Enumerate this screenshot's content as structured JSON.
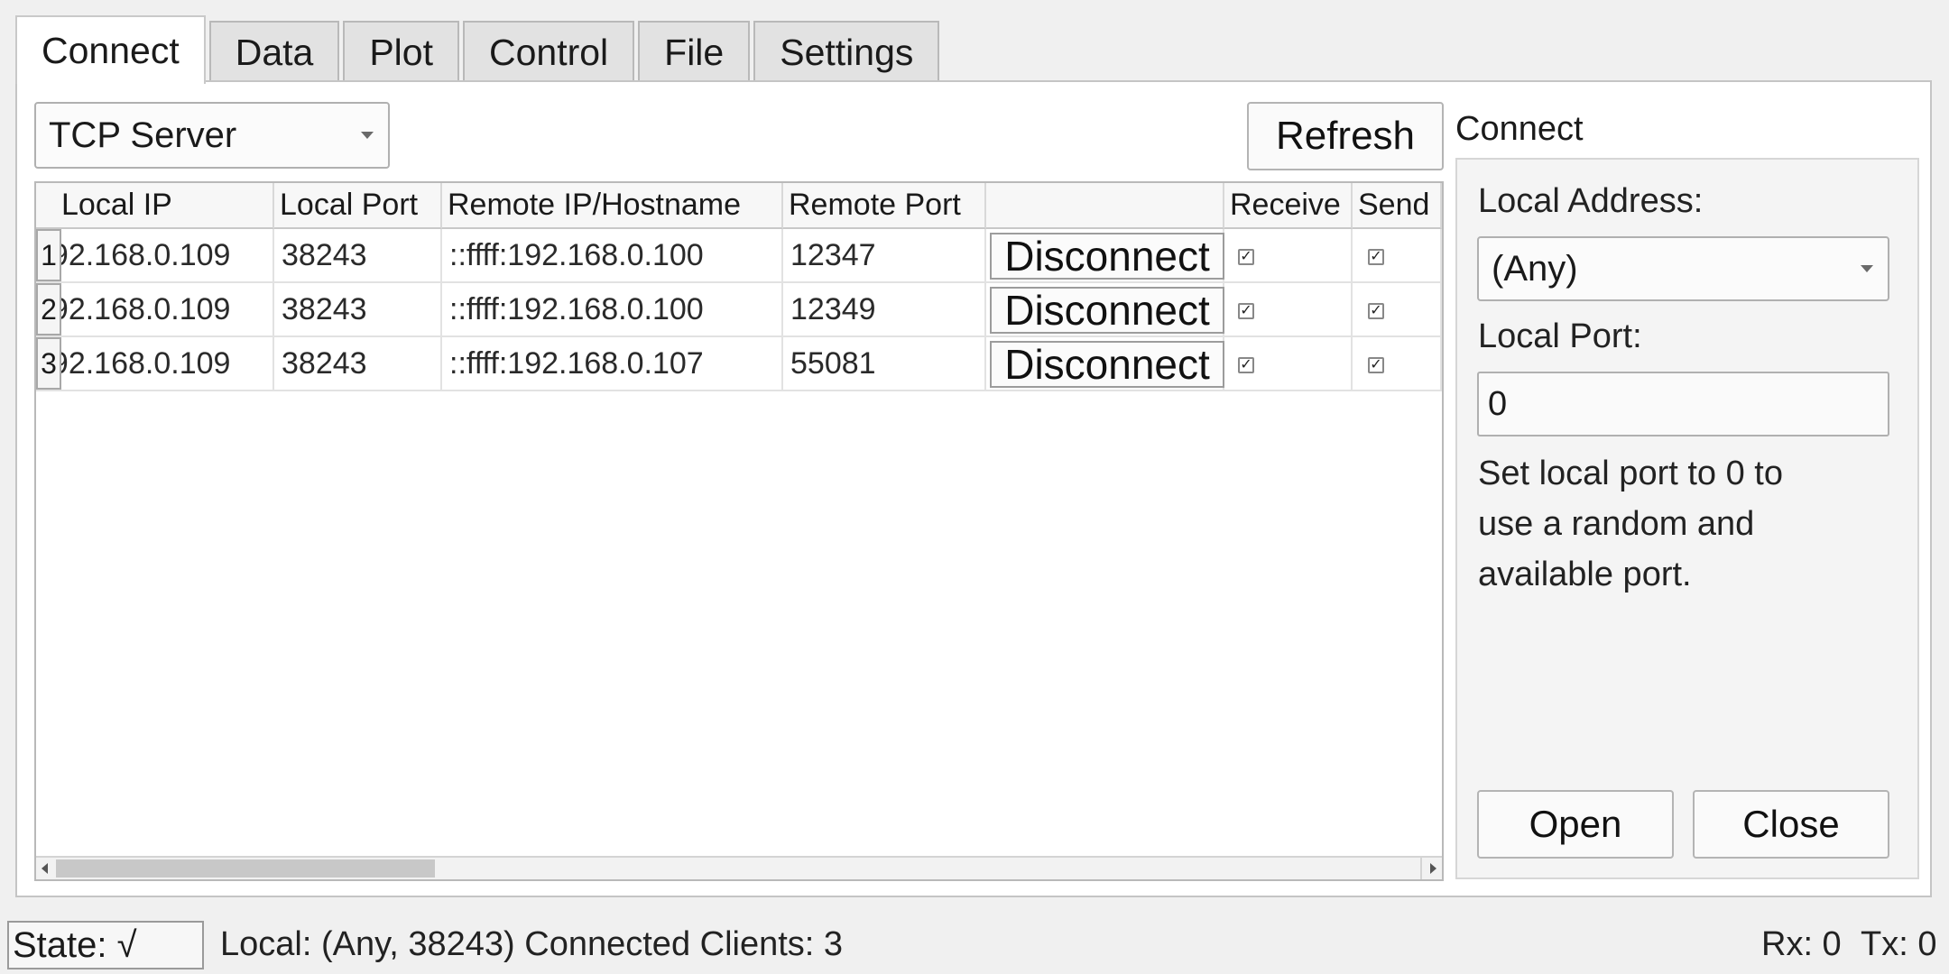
{
  "tabs": [
    "Connect",
    "Data",
    "Plot",
    "Control",
    "File",
    "Settings"
  ],
  "mode_select": "TCP Server",
  "refresh_label": "Refresh",
  "table": {
    "headers": [
      "Local IP",
      "Local Port",
      "Remote IP/Hostname",
      "Remote Port",
      "",
      "Receive",
      "Send"
    ],
    "rows": [
      {
        "num": "1",
        "local_ip": "192.168.0.109",
        "local_port": "38243",
        "remote_ip": "::ffff:192.168.0.100",
        "remote_port": "12347",
        "action": "Disconnect",
        "receive": true,
        "send": true
      },
      {
        "num": "2",
        "local_ip": "192.168.0.109",
        "local_port": "38243",
        "remote_ip": "::ffff:192.168.0.100",
        "remote_port": "12349",
        "action": "Disconnect",
        "receive": true,
        "send": true
      },
      {
        "num": "3",
        "local_ip": "192.168.0.109",
        "local_port": "38243",
        "remote_ip": "::ffff:192.168.0.107",
        "remote_port": "55081",
        "action": "Disconnect",
        "receive": true,
        "send": true
      }
    ]
  },
  "connect": {
    "title": "Connect",
    "local_address_label": "Local Address:",
    "local_address_value": "(Any)",
    "local_port_label": "Local Port:",
    "local_port_value": "0",
    "help_line1": "Set local port to 0 to",
    "help_line2": "use a random and",
    "help_line3": "available port.",
    "open_label": "Open",
    "close_label": "Close"
  },
  "status": {
    "state": "State: √",
    "local": "Local: (Any, 38243) Connected Clients: 3",
    "rx": "Rx: 0",
    "tx": "Tx: 0"
  },
  "checkmark": "✓"
}
